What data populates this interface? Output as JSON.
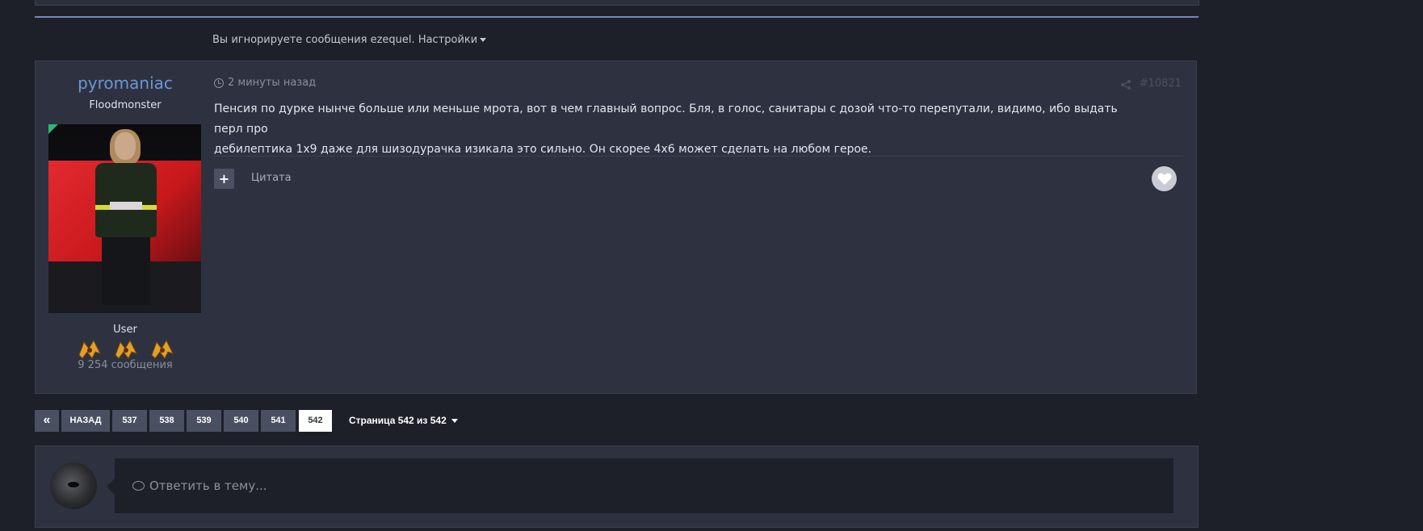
{
  "ignored": {
    "text": "Вы игнорируете сообщения ezequel.",
    "settings_label": "Настройки"
  },
  "post": {
    "author": {
      "name": "pyromaniac",
      "title": "Floodmonster",
      "group": "User",
      "post_count": "9 254 сообщения"
    },
    "time": "2 минуты назад",
    "number": "#10821",
    "body_line1": "Пенсия по дурке нынче больше или меньше мрота, вот в чем главный вопрос. Бля, в голос, санитары с дозой что-то перепутали, видимо, ибо выдать перл про",
    "body_line2": "дебилептика 1х9 даже для шизодурачка изикала это сильно. Он скорее 4х6 может сделать на любом герое.",
    "quote_label": "Цитата"
  },
  "pagination": {
    "first_icon": "«",
    "back_label": "НАЗАД",
    "pages": [
      "537",
      "538",
      "539",
      "540",
      "541",
      "542"
    ],
    "active_page": "542",
    "page_info": "Страница 542 из 542"
  },
  "reply": {
    "placeholder": "Ответить в тему..."
  },
  "colors": {
    "accent": "#6e8bc0",
    "author_name": "#6b96d6",
    "background": "#1e2029",
    "panel": "#2e3240"
  },
  "icons": [
    "clock-icon",
    "share-icon",
    "plus-icon",
    "heart-icon",
    "comment-icon",
    "chevron-double-left-icon",
    "caret-down-icon"
  ]
}
